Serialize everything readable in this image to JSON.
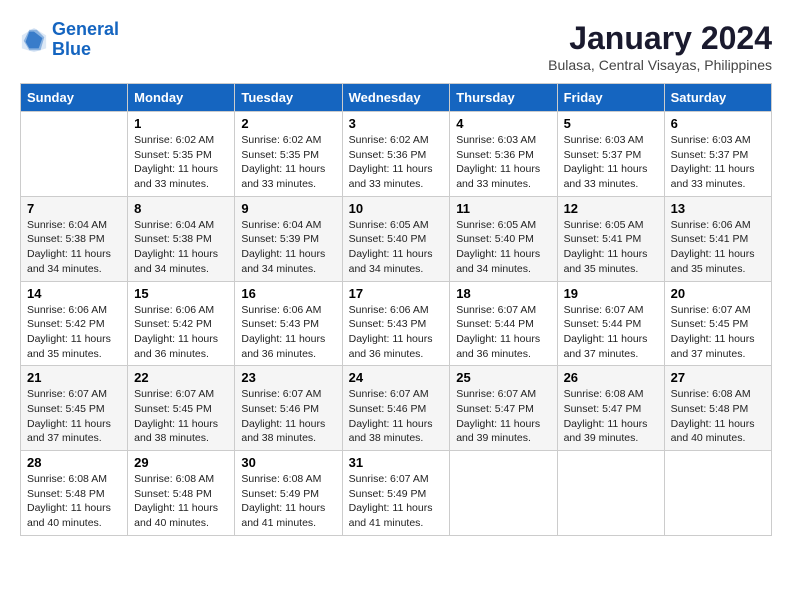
{
  "logo": {
    "line1": "General",
    "line2": "Blue"
  },
  "title": "January 2024",
  "subtitle": "Bulasa, Central Visayas, Philippines",
  "days_header": [
    "Sunday",
    "Monday",
    "Tuesday",
    "Wednesday",
    "Thursday",
    "Friday",
    "Saturday"
  ],
  "weeks": [
    [
      {
        "day": "",
        "sunrise": "",
        "sunset": "",
        "daylight": ""
      },
      {
        "day": "1",
        "sunrise": "Sunrise: 6:02 AM",
        "sunset": "Sunset: 5:35 PM",
        "daylight": "Daylight: 11 hours and 33 minutes."
      },
      {
        "day": "2",
        "sunrise": "Sunrise: 6:02 AM",
        "sunset": "Sunset: 5:35 PM",
        "daylight": "Daylight: 11 hours and 33 minutes."
      },
      {
        "day": "3",
        "sunrise": "Sunrise: 6:02 AM",
        "sunset": "Sunset: 5:36 PM",
        "daylight": "Daylight: 11 hours and 33 minutes."
      },
      {
        "day": "4",
        "sunrise": "Sunrise: 6:03 AM",
        "sunset": "Sunset: 5:36 PM",
        "daylight": "Daylight: 11 hours and 33 minutes."
      },
      {
        "day": "5",
        "sunrise": "Sunrise: 6:03 AM",
        "sunset": "Sunset: 5:37 PM",
        "daylight": "Daylight: 11 hours and 33 minutes."
      },
      {
        "day": "6",
        "sunrise": "Sunrise: 6:03 AM",
        "sunset": "Sunset: 5:37 PM",
        "daylight": "Daylight: 11 hours and 33 minutes."
      }
    ],
    [
      {
        "day": "7",
        "sunrise": "Sunrise: 6:04 AM",
        "sunset": "Sunset: 5:38 PM",
        "daylight": "Daylight: 11 hours and 34 minutes."
      },
      {
        "day": "8",
        "sunrise": "Sunrise: 6:04 AM",
        "sunset": "Sunset: 5:38 PM",
        "daylight": "Daylight: 11 hours and 34 minutes."
      },
      {
        "day": "9",
        "sunrise": "Sunrise: 6:04 AM",
        "sunset": "Sunset: 5:39 PM",
        "daylight": "Daylight: 11 hours and 34 minutes."
      },
      {
        "day": "10",
        "sunrise": "Sunrise: 6:05 AM",
        "sunset": "Sunset: 5:40 PM",
        "daylight": "Daylight: 11 hours and 34 minutes."
      },
      {
        "day": "11",
        "sunrise": "Sunrise: 6:05 AM",
        "sunset": "Sunset: 5:40 PM",
        "daylight": "Daylight: 11 hours and 34 minutes."
      },
      {
        "day": "12",
        "sunrise": "Sunrise: 6:05 AM",
        "sunset": "Sunset: 5:41 PM",
        "daylight": "Daylight: 11 hours and 35 minutes."
      },
      {
        "day": "13",
        "sunrise": "Sunrise: 6:06 AM",
        "sunset": "Sunset: 5:41 PM",
        "daylight": "Daylight: 11 hours and 35 minutes."
      }
    ],
    [
      {
        "day": "14",
        "sunrise": "Sunrise: 6:06 AM",
        "sunset": "Sunset: 5:42 PM",
        "daylight": "Daylight: 11 hours and 35 minutes."
      },
      {
        "day": "15",
        "sunrise": "Sunrise: 6:06 AM",
        "sunset": "Sunset: 5:42 PM",
        "daylight": "Daylight: 11 hours and 36 minutes."
      },
      {
        "day": "16",
        "sunrise": "Sunrise: 6:06 AM",
        "sunset": "Sunset: 5:43 PM",
        "daylight": "Daylight: 11 hours and 36 minutes."
      },
      {
        "day": "17",
        "sunrise": "Sunrise: 6:06 AM",
        "sunset": "Sunset: 5:43 PM",
        "daylight": "Daylight: 11 hours and 36 minutes."
      },
      {
        "day": "18",
        "sunrise": "Sunrise: 6:07 AM",
        "sunset": "Sunset: 5:44 PM",
        "daylight": "Daylight: 11 hours and 36 minutes."
      },
      {
        "day": "19",
        "sunrise": "Sunrise: 6:07 AM",
        "sunset": "Sunset: 5:44 PM",
        "daylight": "Daylight: 11 hours and 37 minutes."
      },
      {
        "day": "20",
        "sunrise": "Sunrise: 6:07 AM",
        "sunset": "Sunset: 5:45 PM",
        "daylight": "Daylight: 11 hours and 37 minutes."
      }
    ],
    [
      {
        "day": "21",
        "sunrise": "Sunrise: 6:07 AM",
        "sunset": "Sunset: 5:45 PM",
        "daylight": "Daylight: 11 hours and 37 minutes."
      },
      {
        "day": "22",
        "sunrise": "Sunrise: 6:07 AM",
        "sunset": "Sunset: 5:45 PM",
        "daylight": "Daylight: 11 hours and 38 minutes."
      },
      {
        "day": "23",
        "sunrise": "Sunrise: 6:07 AM",
        "sunset": "Sunset: 5:46 PM",
        "daylight": "Daylight: 11 hours and 38 minutes."
      },
      {
        "day": "24",
        "sunrise": "Sunrise: 6:07 AM",
        "sunset": "Sunset: 5:46 PM",
        "daylight": "Daylight: 11 hours and 38 minutes."
      },
      {
        "day": "25",
        "sunrise": "Sunrise: 6:07 AM",
        "sunset": "Sunset: 5:47 PM",
        "daylight": "Daylight: 11 hours and 39 minutes."
      },
      {
        "day": "26",
        "sunrise": "Sunrise: 6:08 AM",
        "sunset": "Sunset: 5:47 PM",
        "daylight": "Daylight: 11 hours and 39 minutes."
      },
      {
        "day": "27",
        "sunrise": "Sunrise: 6:08 AM",
        "sunset": "Sunset: 5:48 PM",
        "daylight": "Daylight: 11 hours and 40 minutes."
      }
    ],
    [
      {
        "day": "28",
        "sunrise": "Sunrise: 6:08 AM",
        "sunset": "Sunset: 5:48 PM",
        "daylight": "Daylight: 11 hours and 40 minutes."
      },
      {
        "day": "29",
        "sunrise": "Sunrise: 6:08 AM",
        "sunset": "Sunset: 5:48 PM",
        "daylight": "Daylight: 11 hours and 40 minutes."
      },
      {
        "day": "30",
        "sunrise": "Sunrise: 6:08 AM",
        "sunset": "Sunset: 5:49 PM",
        "daylight": "Daylight: 11 hours and 41 minutes."
      },
      {
        "day": "31",
        "sunrise": "Sunrise: 6:07 AM",
        "sunset": "Sunset: 5:49 PM",
        "daylight": "Daylight: 11 hours and 41 minutes."
      },
      {
        "day": "",
        "sunrise": "",
        "sunset": "",
        "daylight": ""
      },
      {
        "day": "",
        "sunrise": "",
        "sunset": "",
        "daylight": ""
      },
      {
        "day": "",
        "sunrise": "",
        "sunset": "",
        "daylight": ""
      }
    ]
  ]
}
